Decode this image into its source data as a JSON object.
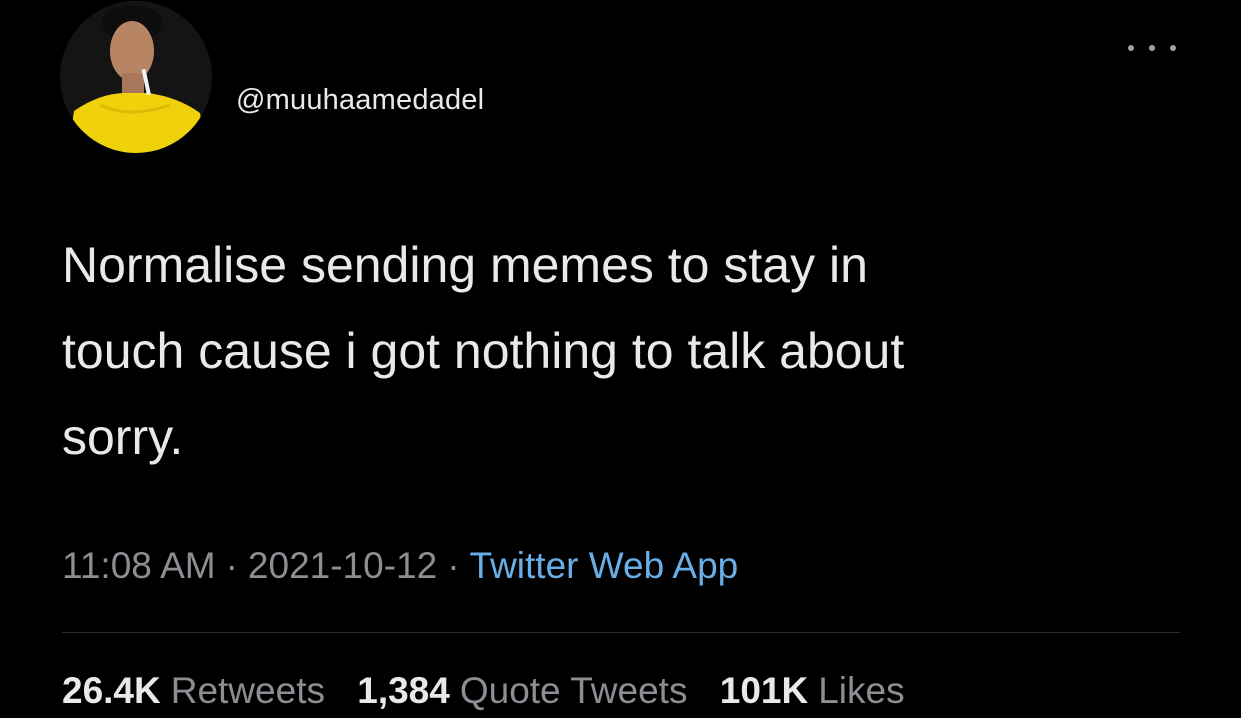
{
  "tweet": {
    "handle": "@muuhaamedadel",
    "text": "Normalise sending memes to stay in\ntouch cause i got nothing to talk about\nsorry.",
    "time": "11:08 AM",
    "separator": "·",
    "date": "2021-10-12",
    "source": "Twitter Web App",
    "stats": {
      "retweets": {
        "count": "26.4K",
        "label": "Retweets"
      },
      "quotes": {
        "count": "1,384",
        "label": "Quote Tweets"
      },
      "likes": {
        "count": "101K",
        "label": "Likes"
      }
    }
  },
  "icons": {
    "more": "more-horizontal-icon",
    "avatar": "profile-avatar"
  },
  "colors": {
    "background": "#000000",
    "text": "#e7e9ea",
    "muted": "#8b8f94",
    "link": "#6aaee8",
    "divider": "#2a2d31"
  }
}
